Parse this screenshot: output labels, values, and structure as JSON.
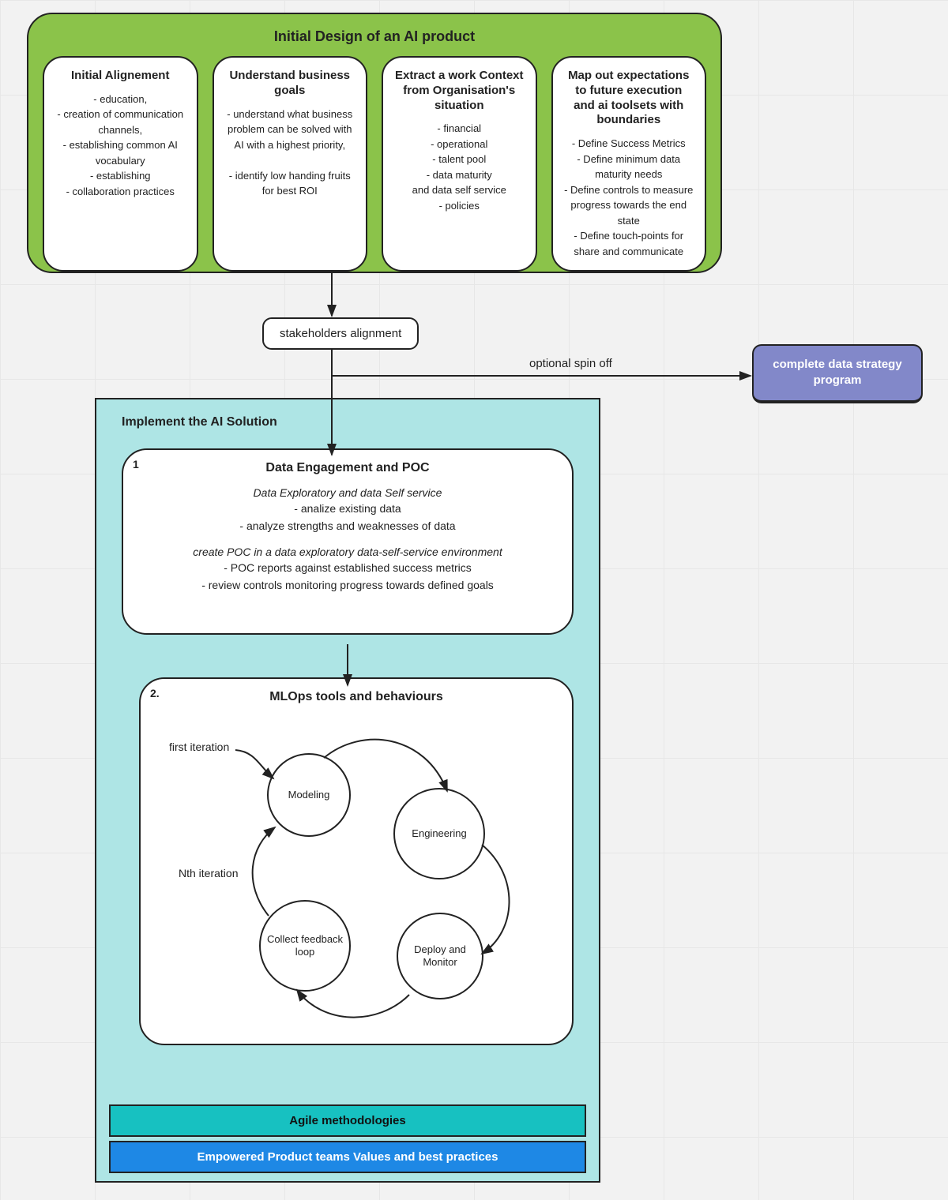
{
  "topPanel": {
    "title": "Initial Design of an AI product",
    "cards": [
      {
        "title": "Initial Alignement",
        "body": "- education,\n- creation of communication channels,\n- establishing common AI vocabulary\n- establishing\n- collaboration practices"
      },
      {
        "title": "Understand business goals",
        "body": "- understand what business problem can be solved with AI with a highest priority,\n\n- identify low handing fruits for best ROI"
      },
      {
        "title": "Extract a  work Context  from Organisation's situation",
        "body": "- financial\n- operational\n- talent pool\n- data maturity\nand data self service\n- policies"
      },
      {
        "title": "Map out expectations to future execution and ai toolsets with boundaries",
        "body": "- Define Success Metrics\n- Define minimum data maturity needs\n- Define controls to measure progress towards the end state\n- Define touch-points for share and communicate"
      }
    ]
  },
  "stakeholders": "stakeholders alignment",
  "spinOffLabel": "optional spin off",
  "spinOffNode": "complete data strategy program",
  "implPanel": {
    "title": "Implement the AI Solution",
    "poc": {
      "num": "1",
      "title": "Data Engagement and POC",
      "sub1": "Data Exploratory and data Self service",
      "lines1": "- analize existing data\n- analyze strengths and weaknesses of data",
      "sub2": "create POC in a data exploratory data-self-service environment",
      "lines2": "- POC reports against established success metrics\n- review controls monitoring progress towards defined  goals"
    },
    "mlops": {
      "num": "2.",
      "title": "MLOps tools and behaviours",
      "firstIter": "first iteration",
      "nthIter": "Nth iteration",
      "circles": {
        "modeling": "Modeling",
        "engineering": "Engineering",
        "deploy": "Deploy and Monitor",
        "feedback": "Collect feedback loop"
      }
    },
    "bars": {
      "agile": "Agile methodologies",
      "empower": "Empowered Product teams Values and best practices"
    }
  }
}
